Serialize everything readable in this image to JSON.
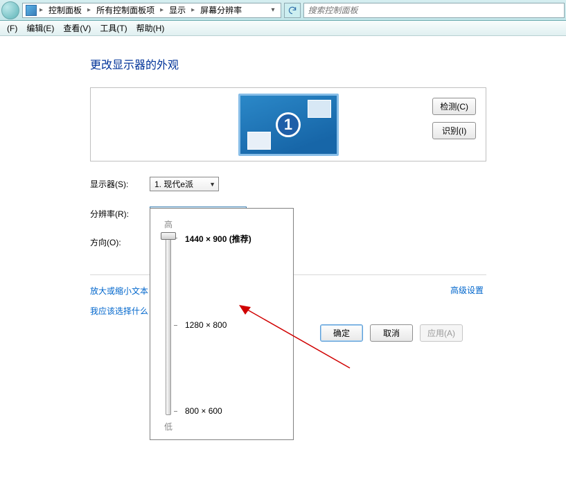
{
  "breadcrumb": {
    "items": [
      "控制面板",
      "所有控制面板项",
      "显示",
      "屏幕分辨率"
    ]
  },
  "search": {
    "placeholder": "搜索控制面板"
  },
  "menu": {
    "file": "(F)",
    "edit": "编辑(E)",
    "view": "查看(V)",
    "tools": "工具(T)",
    "help": "帮助(H)"
  },
  "page": {
    "title": "更改显示器的外观"
  },
  "panel": {
    "monitor_number": "1",
    "detect_label": "检测(C)",
    "identify_label": "识别(I)"
  },
  "form": {
    "display_label": "显示器(S):",
    "display_value": "1. 现代e派",
    "resolution_label": "分辨率(R):",
    "resolution_value": "1440 × 900 (推荐)",
    "orientation_label": "方向(O):"
  },
  "advanced": {
    "label": "高级设置"
  },
  "links": {
    "zoom": "放大或缩小文本",
    "which": "我应该选择什么"
  },
  "buttons": {
    "ok": "确定",
    "cancel": "取消",
    "apply": "应用(A)"
  },
  "slider": {
    "high": "高",
    "low": "低",
    "options": [
      "1440 × 900 (推荐)",
      "1280 × 800",
      "800 × 600"
    ]
  }
}
